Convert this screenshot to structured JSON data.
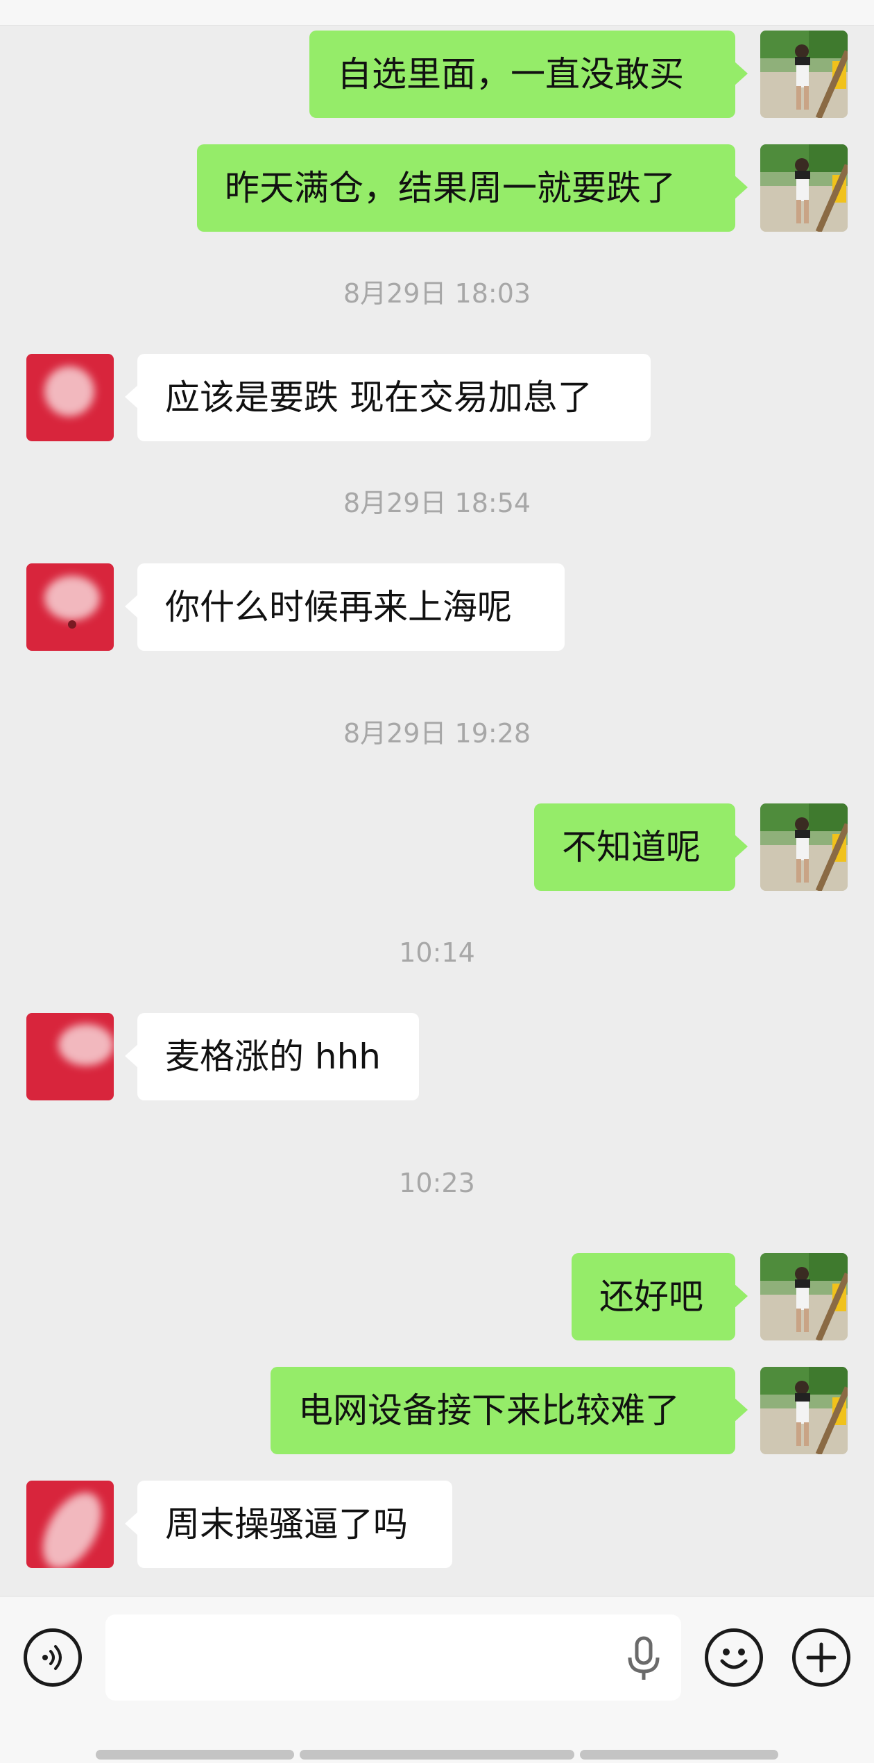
{
  "messages": {
    "m1": "自选里面，一直没敢买",
    "m2": "昨天满仓，结果周一就要跌了",
    "m3": "应该是要跌 现在交易加息了",
    "m4": "你什么时候再来上海呢",
    "m5": "不知道呢",
    "m6": "麦格涨的 hhh",
    "m7": "还好吧",
    "m8": "电网设备接下来比较难了",
    "m9": "周末操骚逼了吗"
  },
  "timestamps": {
    "t1": "8月29日 18:03",
    "t2": "8月29日 18:54",
    "t3": "8月29日 19:28",
    "t4": "10:14",
    "t5": "10:23"
  },
  "input": {
    "value": "",
    "placeholder": ""
  },
  "icons": {
    "voice": "voice-icon",
    "mic": "microphone-icon",
    "emoji": "emoji-icon",
    "plus": "plus-icon"
  },
  "colors": {
    "background": "#ededed",
    "my_bubble": "#95ec69",
    "their_bubble": "#ffffff",
    "their_avatar": "#d8253c",
    "timestamp": "#a7a7a7"
  }
}
